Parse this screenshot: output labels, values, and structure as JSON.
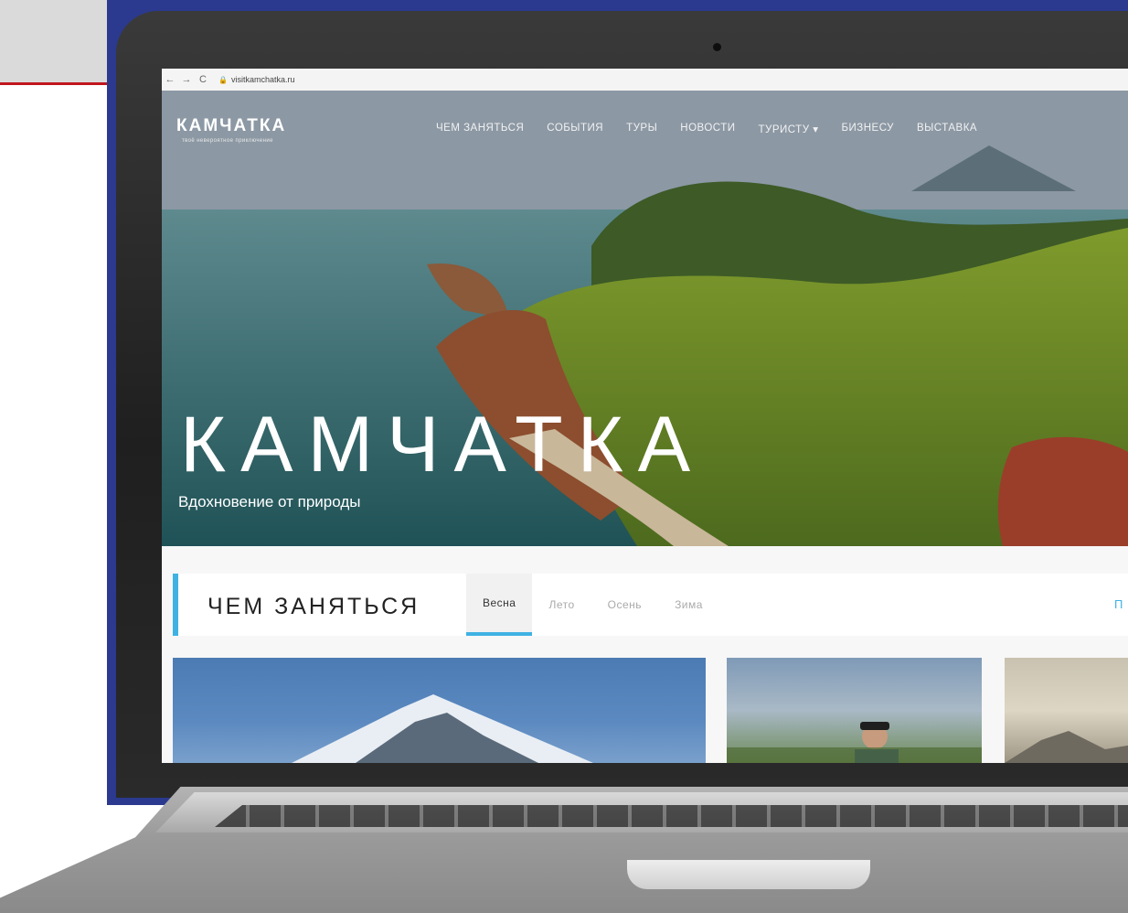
{
  "browser": {
    "back_icon": "←",
    "forward_icon": "→",
    "reload_icon": "C",
    "url": "visitkamchatka.ru"
  },
  "site": {
    "logo": "КАМЧАТКА",
    "tagline": "твоё невероятное приключение"
  },
  "nav": {
    "items": [
      {
        "label": "ЧЕМ ЗАНЯТЬСЯ"
      },
      {
        "label": "СОБЫТИЯ"
      },
      {
        "label": "ТУРЫ"
      },
      {
        "label": "НОВОСТИ"
      },
      {
        "label": "ТУРИСТУ ▾"
      },
      {
        "label": "БИЗНЕСУ"
      },
      {
        "label": "ВЫСТАВКА"
      }
    ]
  },
  "hero": {
    "title": "КАМЧАТКА",
    "subtitle": "Вдохновение от природы"
  },
  "section": {
    "title": "ЧЕМ ЗАНЯТЬСЯ",
    "tabs": [
      {
        "label": "Весна",
        "active": true
      },
      {
        "label": "Лето",
        "active": false
      },
      {
        "label": "Осень",
        "active": false
      },
      {
        "label": "Зима",
        "active": false
      }
    ],
    "more_link": "П"
  },
  "colors": {
    "accent": "#3fb2e3",
    "slide_blue": "#2b3a8e",
    "slide_red": "#c0161d"
  }
}
